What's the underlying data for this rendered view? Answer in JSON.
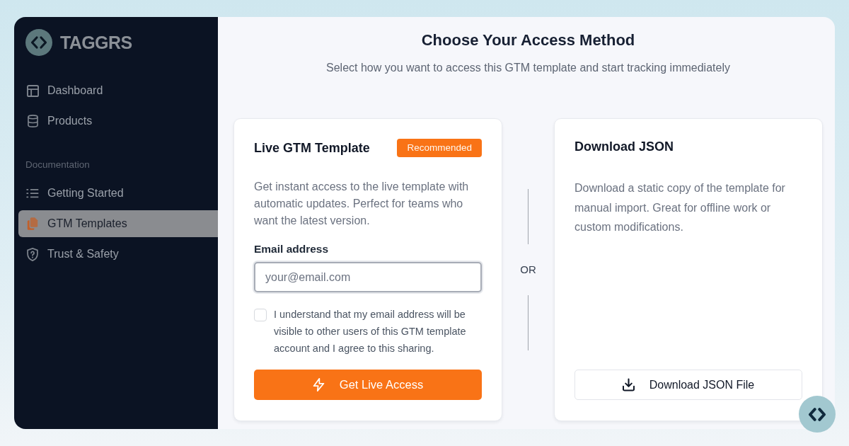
{
  "sidebar": {
    "brand": "TAGGRS",
    "groups": [
      {
        "items": [
          {
            "label": "Dashboard",
            "selected": false
          },
          {
            "label": "Products",
            "selected": false
          }
        ]
      },
      {
        "heading": "Documentation",
        "items": [
          {
            "label": "Getting Started",
            "selected": false
          },
          {
            "label": "GTM Templates",
            "selected": true
          },
          {
            "label": "Trust & Safety",
            "selected": false
          }
        ]
      }
    ]
  },
  "main": {
    "title": "Choose Your Access Method",
    "subtitle": "Select how you want to access this GTM template and start tracking immediately"
  },
  "live_card": {
    "title": "Live GTM Template",
    "badge": "Recommended",
    "description": "Get instant access to the live template with automatic updates. Perfect for teams who want the latest version.",
    "email": {
      "label": "Email address",
      "placeholder": "your@email.com"
    },
    "consent": {
      "text": "I understand that my email address will be visible to other users of this GTM template account and I agree to this sharing.",
      "checked": false
    },
    "button": "Get Live Access"
  },
  "divider": "OR",
  "download_card": {
    "title": "Download JSON",
    "description": "Download a static copy of the template for manual import. Great for offline work or custom modifications.",
    "button": "Download JSON File"
  }
}
